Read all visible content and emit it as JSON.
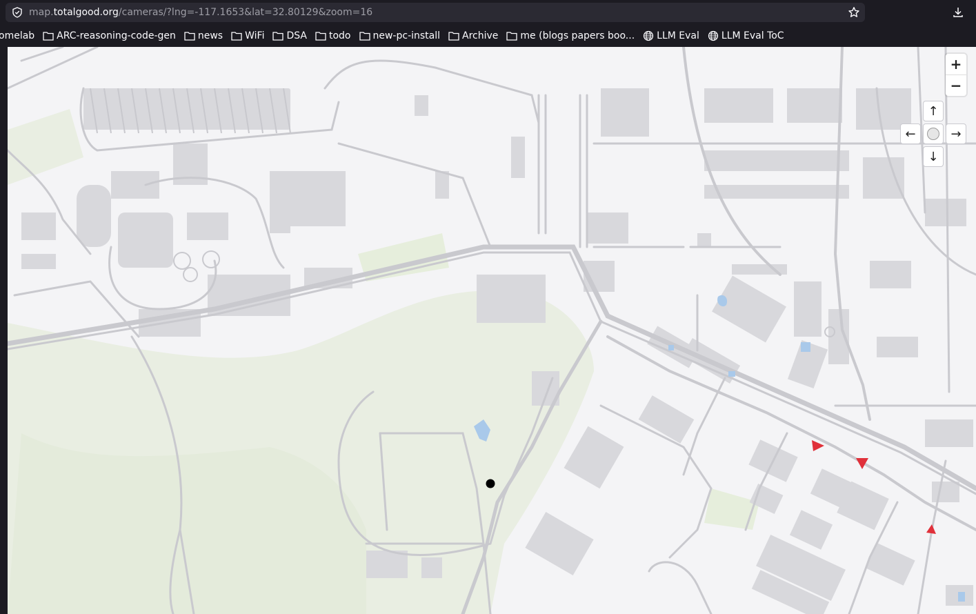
{
  "browser": {
    "url_prefix": "map.",
    "url_domain": "totalgood.org",
    "url_path": "/cameras/?lng=-117.1653&lat=32.80129&zoom=16"
  },
  "bookmarks": [
    {
      "label": "omelab",
      "icon": "none"
    },
    {
      "label": "ARC-reasoning-code-gen",
      "icon": "folder-icon"
    },
    {
      "label": "news",
      "icon": "folder-icon"
    },
    {
      "label": "WiFi",
      "icon": "folder-icon"
    },
    {
      "label": "DSA",
      "icon": "folder-icon"
    },
    {
      "label": "todo",
      "icon": "folder-icon"
    },
    {
      "label": "new-pc-install",
      "icon": "folder-icon"
    },
    {
      "label": "Archive",
      "icon": "folder-icon"
    },
    {
      "label": "me (blogs papers boo...",
      "icon": "folder-icon"
    },
    {
      "label": "LLM Eval",
      "icon": "globe-icon"
    },
    {
      "label": "LLM Eval ToC",
      "icon": "globe-icon"
    }
  ],
  "map_controls": {
    "zoom_in": "+",
    "zoom_out": "−",
    "pan_up": "↑",
    "pan_left": "←",
    "pan_right": "→",
    "pan_down": "↓"
  },
  "colors": {
    "map_background": "#f4f4f6",
    "road": "#c9c9ce",
    "building": "#d9d9dd",
    "park": "#e8efe0",
    "water": "#a9c9ea",
    "camera_marker": "#e0303a",
    "location_marker": "#000000"
  }
}
